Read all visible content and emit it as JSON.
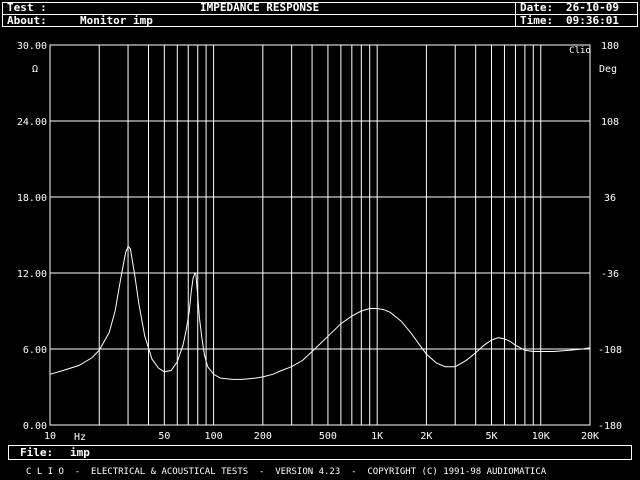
{
  "header": {
    "test_label": "Test :",
    "title": "IMPEDANCE RESPONSE",
    "about_label": "About:",
    "about_value": "Monitor imp",
    "date_label": "Date:",
    "date_value": "26-10-09",
    "time_label": "Time:",
    "time_value": "09:36:01"
  },
  "footer": {
    "file_label": "File:",
    "file_value": "imp",
    "banner": "C L I O  -  ELECTRICAL & ACOUSTICAL TESTS  -  VERSION 4.23  -  COPYRIGHT (C) 1991-98 AUDIOMATICA"
  },
  "chart_data": {
    "type": "line",
    "xscale": "log",
    "xlim": [
      10,
      20000
    ],
    "ylim": [
      0,
      30
    ],
    "y2lim": [
      -180,
      180
    ],
    "ylabel": "Ω",
    "y2label": "Deg",
    "xlabel": "Hz",
    "brand_label": "Clio",
    "x_tick_labels": [
      {
        "x": 10,
        "label": "10"
      },
      {
        "x": 50,
        "label": "50"
      },
      {
        "x": 100,
        "label": "100"
      },
      {
        "x": 200,
        "label": "200"
      },
      {
        "x": 500,
        "label": "500"
      },
      {
        "x": 1000,
        "label": "1K"
      },
      {
        "x": 2000,
        "label": "2K"
      },
      {
        "x": 5000,
        "label": "5K"
      },
      {
        "x": 10000,
        "label": "10K"
      },
      {
        "x": 20000,
        "label": "20K"
      }
    ],
    "y_tick_labels": [
      "0.00",
      "6.00",
      "12.00",
      "18.00",
      "24.00",
      "30.00"
    ],
    "y2_tick_labels": [
      "-180",
      "-108",
      "-36",
      "36",
      "108",
      "180"
    ],
    "grid": true,
    "series": [
      {
        "x": [
          10,
          12,
          15,
          18,
          20,
          23,
          25,
          27,
          29,
          30,
          31,
          33,
          35,
          38,
          42,
          46,
          50,
          55,
          60,
          65,
          68,
          71,
          73,
          75,
          77,
          78,
          80,
          82,
          85,
          88,
          92,
          100,
          110,
          130,
          150,
          180,
          200,
          230,
          260,
          300,
          350,
          400,
          500,
          600,
          700,
          800,
          900,
          1000,
          1100,
          1200,
          1400,
          1600,
          1800,
          2000,
          2300,
          2600,
          3000,
          3500,
          4000,
          4500,
          5000,
          5500,
          6000,
          6500,
          7000,
          8000,
          9000,
          10000,
          12000,
          15000,
          18000,
          20000
        ],
        "y": [
          4.0,
          4.3,
          4.7,
          5.3,
          5.9,
          7.3,
          9.0,
          11.5,
          13.6,
          14.1,
          13.9,
          11.8,
          9.5,
          7.0,
          5.2,
          4.5,
          4.2,
          4.3,
          5.0,
          6.3,
          7.5,
          9.0,
          10.5,
          11.6,
          12.0,
          11.9,
          10.2,
          8.4,
          6.8,
          5.5,
          4.6,
          4.0,
          3.7,
          3.6,
          3.6,
          3.7,
          3.8,
          4.0,
          4.3,
          4.6,
          5.1,
          5.8,
          7.0,
          8.0,
          8.6,
          9.0,
          9.2,
          9.2,
          9.1,
          8.9,
          8.2,
          7.3,
          6.4,
          5.6,
          4.9,
          4.6,
          4.6,
          5.1,
          5.7,
          6.3,
          6.7,
          6.9,
          6.8,
          6.6,
          6.3,
          5.9,
          5.8,
          5.8,
          5.8,
          5.9,
          6.0,
          6.1
        ]
      }
    ]
  }
}
